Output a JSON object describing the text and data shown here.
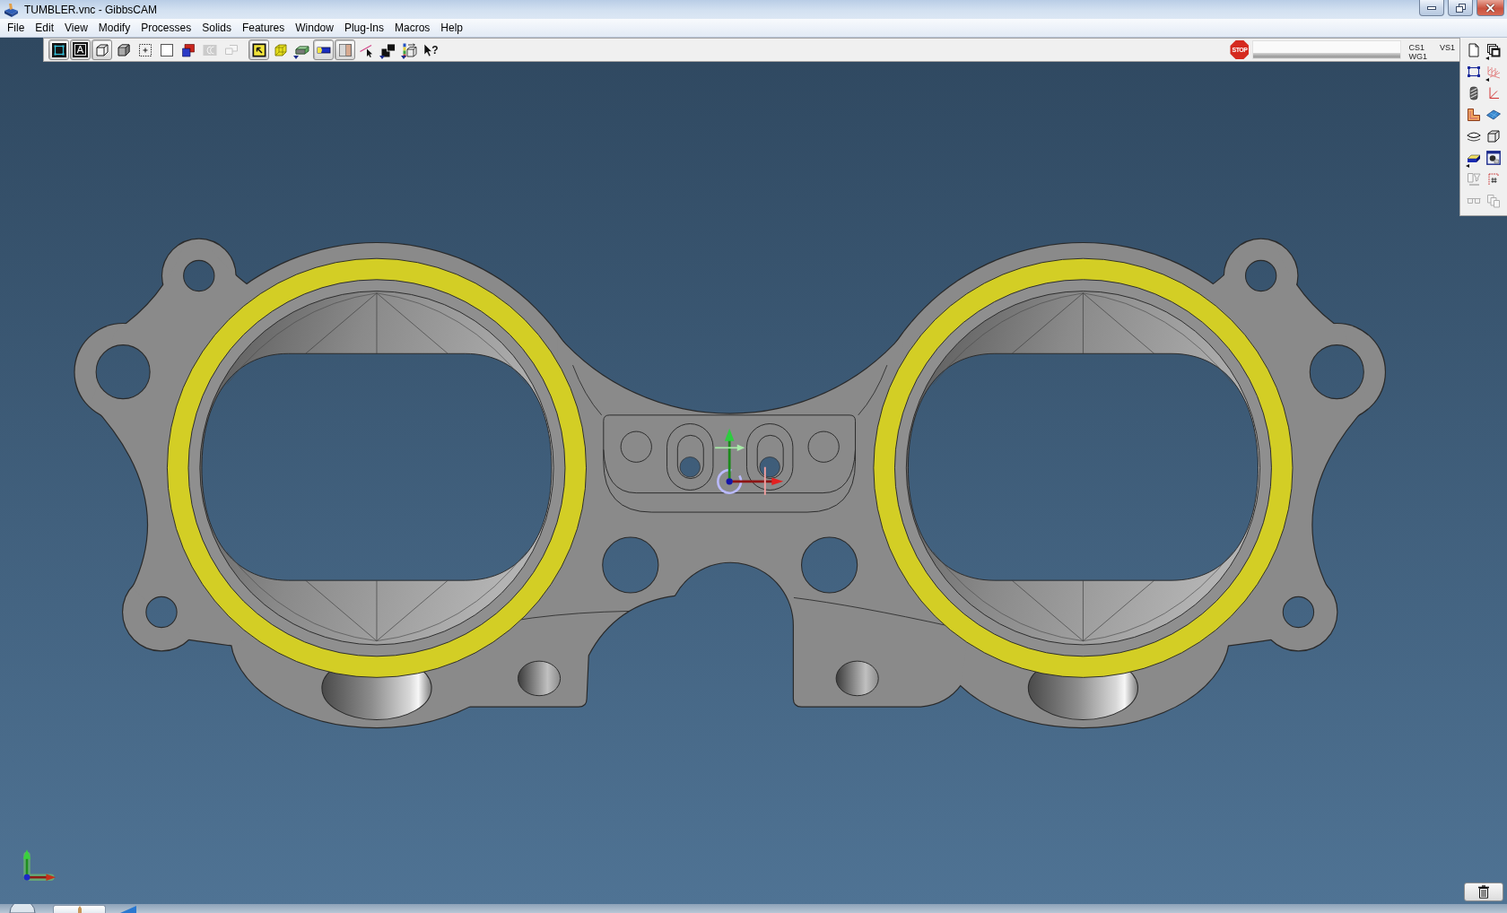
{
  "window": {
    "title": "TUMBLER.vnc - GibbsCAM"
  },
  "menu": [
    "File",
    "Edit",
    "View",
    "Modify",
    "Processes",
    "Solids",
    "Features",
    "Window",
    "Plug-Ins",
    "Macros",
    "Help"
  ],
  "toolbar": {
    "groups": [
      [
        {
          "kind": "wireframe",
          "selected": true,
          "disabled": false,
          "dropdown": false
        },
        {
          "kind": "text_frame",
          "glyph": "A",
          "selected": true,
          "disabled": false,
          "dropdown": false
        },
        {
          "kind": "cube_outline",
          "selected": true,
          "disabled": false,
          "dropdown": false
        },
        {
          "kind": "cube_shaded",
          "selected": false,
          "disabled": false,
          "dropdown": false
        },
        {
          "kind": "dotted_square",
          "selected": false,
          "disabled": false,
          "dropdown": false
        },
        {
          "kind": "empty_square",
          "selected": false,
          "disabled": false,
          "dropdown": false
        },
        {
          "kind": "corner_shape",
          "selected": false,
          "disabled": false,
          "dropdown": false
        },
        {
          "kind": "c_shape",
          "selected": false,
          "disabled": true,
          "dropdown": false
        },
        {
          "kind": "outline_shape",
          "selected": false,
          "disabled": true,
          "dropdown": false
        }
      ],
      [
        {
          "kind": "box_arrow",
          "selected": true,
          "disabled": false,
          "dropdown": false
        },
        {
          "kind": "wire_cube",
          "selected": false,
          "disabled": false,
          "dropdown": false
        },
        {
          "kind": "slab",
          "selected": false,
          "disabled": false,
          "dropdown": true
        },
        {
          "kind": "bar",
          "selected": true,
          "disabled": false,
          "dropdown": false
        },
        {
          "kind": "layered_box",
          "selected": true,
          "disabled": false,
          "dropdown": false
        },
        {
          "kind": "line_cursor",
          "selected": false,
          "disabled": false,
          "dropdown": false
        },
        {
          "kind": "stacked_squares",
          "selected": false,
          "disabled": false,
          "dropdown": true
        },
        {
          "kind": "box_rotate",
          "selected": false,
          "disabled": false,
          "dropdown": true
        },
        {
          "kind": "help",
          "glyph": "?",
          "selected": false,
          "disabled": false,
          "dropdown": false
        }
      ]
    ],
    "stop_button": {
      "label": "STOP"
    },
    "progress": {
      "level": 1
    },
    "readouts": [
      [
        "CS1",
        "WG1"
      ],
      [
        "VS1"
      ]
    ]
  },
  "side_toolbar": {
    "buttons": [
      {
        "kind": "new_document",
        "disabled": false,
        "dropdown": false
      },
      {
        "kind": "cascade",
        "disabled": false,
        "dropdown": true
      },
      {
        "kind": "rect_handles",
        "disabled": false,
        "dropdown": false
      },
      {
        "kind": "multi_axes",
        "disabled": false,
        "dropdown": true
      },
      {
        "kind": "end_mill",
        "disabled": false,
        "dropdown": false
      },
      {
        "kind": "axis",
        "disabled": false,
        "dropdown": false
      },
      {
        "kind": "profile",
        "disabled": false,
        "dropdown": false
      },
      {
        "kind": "plane",
        "disabled": false,
        "dropdown": false
      },
      {
        "kind": "lens",
        "disabled": false,
        "dropdown": false
      },
      {
        "kind": "cube",
        "disabled": false,
        "dropdown": false
      },
      {
        "kind": "slab_two_tone",
        "disabled": false,
        "dropdown": true
      },
      {
        "kind": "sphere_window",
        "disabled": false,
        "dropdown": false
      },
      {
        "kind": "doc_funnel",
        "disabled": true,
        "dropdown": false
      },
      {
        "kind": "bracket_grid",
        "disabled": false,
        "dropdown": false
      },
      {
        "kind": "dashed_bars",
        "disabled": true,
        "dropdown": false
      },
      {
        "kind": "copies",
        "disabled": true,
        "dropdown": false
      }
    ]
  }
}
